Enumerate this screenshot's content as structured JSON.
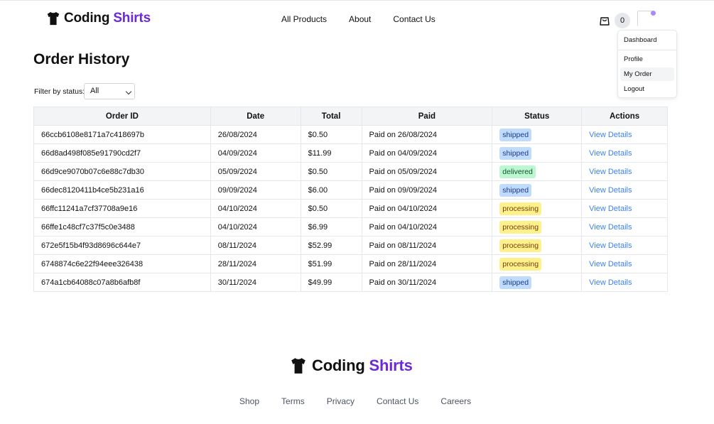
{
  "brand": {
    "part1": "Coding",
    "part2": "Shirts"
  },
  "nav": {
    "links": [
      "All Products",
      "About",
      "Contact Us"
    ]
  },
  "cart": {
    "count": "0"
  },
  "user_menu": {
    "items": [
      "Dashboard",
      "Profile",
      "My Order",
      "Logout"
    ],
    "active": "My Order"
  },
  "page": {
    "title": "Order History"
  },
  "filter": {
    "label": "Filter by status:",
    "value": "All"
  },
  "table": {
    "headers": [
      "Order ID",
      "Date",
      "Total",
      "Paid",
      "Status",
      "Actions"
    ],
    "rows": [
      {
        "id": "66ccb6108e8171a7c418697b",
        "date": "26/08/2024",
        "total": "$0.50",
        "paid": "Paid on 26/08/2024",
        "status": "shipped",
        "action": "View Details"
      },
      {
        "id": "66d8ad498f085e91790cd2f7",
        "date": "04/09/2024",
        "total": "$11.99",
        "paid": "Paid on 04/09/2024",
        "status": "shipped",
        "action": "View Details"
      },
      {
        "id": "66d9ce9070b07c6e88c7db30",
        "date": "05/09/2024",
        "total": "$0.50",
        "paid": "Paid on 05/09/2024",
        "status": "delivered",
        "action": "View Details"
      },
      {
        "id": "66dec8120411b4ce5b231a16",
        "date": "09/09/2024",
        "total": "$6.00",
        "paid": "Paid on 09/09/2024",
        "status": "shipped",
        "action": "View Details"
      },
      {
        "id": "66ffc11241a7cf37708a9e16",
        "date": "04/10/2024",
        "total": "$0.50",
        "paid": "Paid on 04/10/2024",
        "status": "processing",
        "action": "View Details"
      },
      {
        "id": "66ffe1c48cf7c37f5c0e3488",
        "date": "04/10/2024",
        "total": "$6.99",
        "paid": "Paid on 04/10/2024",
        "status": "processing",
        "action": "View Details"
      },
      {
        "id": "672e5f15b4f93d8696c644e7",
        "date": "08/11/2024",
        "total": "$52.99",
        "paid": "Paid on 08/11/2024",
        "status": "processing",
        "action": "View Details"
      },
      {
        "id": "6748874c6e22f94eee326438",
        "date": "28/11/2024",
        "total": "$51.99",
        "paid": "Paid on 28/11/2024",
        "status": "processing",
        "action": "View Details"
      },
      {
        "id": "674a1cb64088c07a8b6afb8f",
        "date": "30/11/2024",
        "total": "$49.99",
        "paid": "Paid on 30/11/2024",
        "status": "shipped",
        "action": "View Details"
      }
    ]
  },
  "footer": {
    "links": [
      "Shop",
      "Terms",
      "Privacy",
      "Contact Us",
      "Careers"
    ]
  },
  "colors": {
    "brand_accent": "#6d28d9",
    "paid": "#22a04b",
    "link": "#3b82f6",
    "shipped_bg": "#bfdbfe",
    "delivered_bg": "#bbf7d0",
    "processing_bg": "#fef08a"
  },
  "icons": {
    "logo": "tshirt-icon",
    "cart": "shopping-bag-icon",
    "avatar": "avatar-image",
    "select": "chevron-down-icon"
  }
}
